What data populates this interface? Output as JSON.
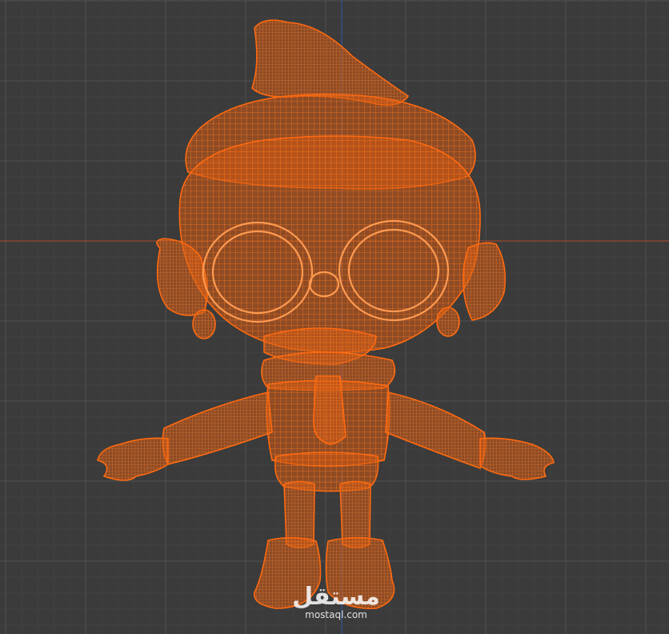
{
  "viewport": {
    "background": "#3b3b3b",
    "grid_minor_color": "#434343",
    "grid_major_color": "#4c4c4c",
    "axis_x_color": "#a44a2a",
    "axis_y_color": "#2f5aa8",
    "wire_color": "#ff6a10",
    "fill_color": "#d35a12"
  },
  "watermark": {
    "arabic": "مستقل",
    "latin": "mostaql.com",
    "color": "#ffffff"
  }
}
